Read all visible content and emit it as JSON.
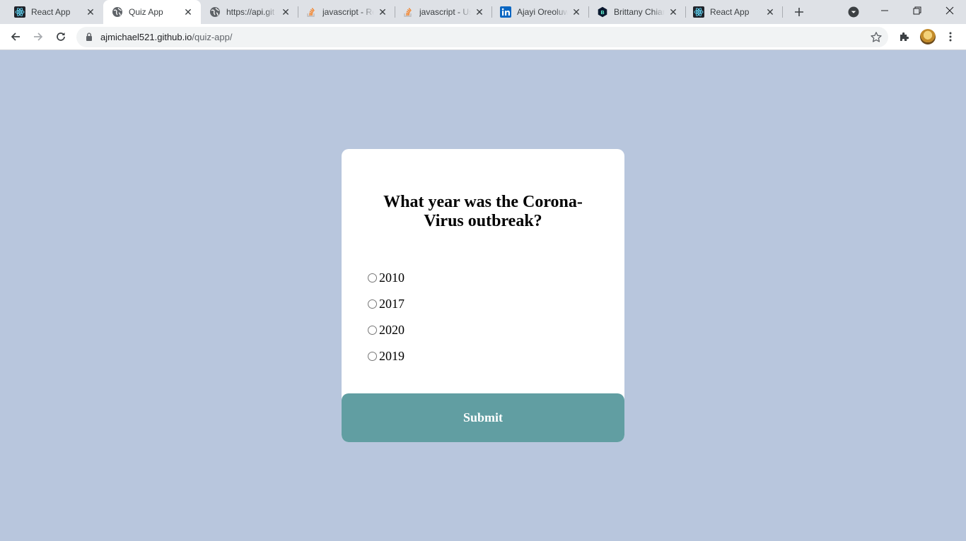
{
  "browser": {
    "tabs": [
      {
        "title": "React App",
        "icon": "react-icon"
      },
      {
        "title": "Quiz App",
        "icon": "globe-icon",
        "active": true
      },
      {
        "title": "https://api.git",
        "icon": "globe-icon"
      },
      {
        "title": "javascript - Re",
        "icon": "stackoverflow-icon"
      },
      {
        "title": "javascript - Us",
        "icon": "stackoverflow-icon"
      },
      {
        "title": "Ajayi Oreoluw",
        "icon": "linkedin-icon"
      },
      {
        "title": "Brittany Chian",
        "icon": "b-logo-icon"
      },
      {
        "title": "React App",
        "icon": "react-icon"
      }
    ],
    "url": {
      "domain": "ajmichael521.github.io",
      "path": "/quiz-app/"
    }
  },
  "quiz": {
    "question": "What year was the Corona-Virus outbreak?",
    "answers": [
      "2010",
      "2017",
      "2020",
      "2019"
    ],
    "submit_label": "Submit"
  },
  "colors": {
    "page_background": "#b8c6dd",
    "card_background": "#ffffff",
    "submit_background": "#619ea2"
  }
}
